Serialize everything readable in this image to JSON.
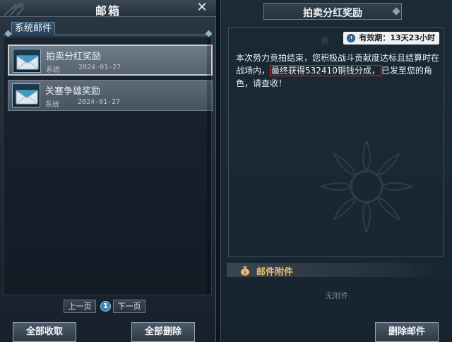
{
  "left": {
    "title": "邮箱",
    "close_icon": "close-icon",
    "tab": "系统邮件",
    "mails": [
      {
        "title": "拍卖分红奖励",
        "sender": "系统",
        "date": "2024-01-27",
        "selected": true
      },
      {
        "title": "关塞争雄奖励",
        "sender": "系统",
        "date": "2024-01-27",
        "selected": false
      }
    ],
    "pager": {
      "prev": "上一页",
      "page": "1",
      "next": "下一页"
    },
    "collect_all": "全部收取",
    "delete_all": "全部删除"
  },
  "right": {
    "title": "拍卖分红奖励",
    "validity": "有效期：13天23小时",
    "body_before": "本次势力竞拍结束，您积极战斗贡献度达标且结算时在战场内，",
    "body_highlight": "最终获得532410铜钱分成，",
    "body_after": "已发至您的角色，请查收！",
    "attachment_label": "邮件附件",
    "no_attachment": "无附件",
    "delete_button": "删除邮件"
  },
  "colors": {
    "highlight_border": "#e0231f",
    "attachment_label": "#e7bd6f"
  }
}
